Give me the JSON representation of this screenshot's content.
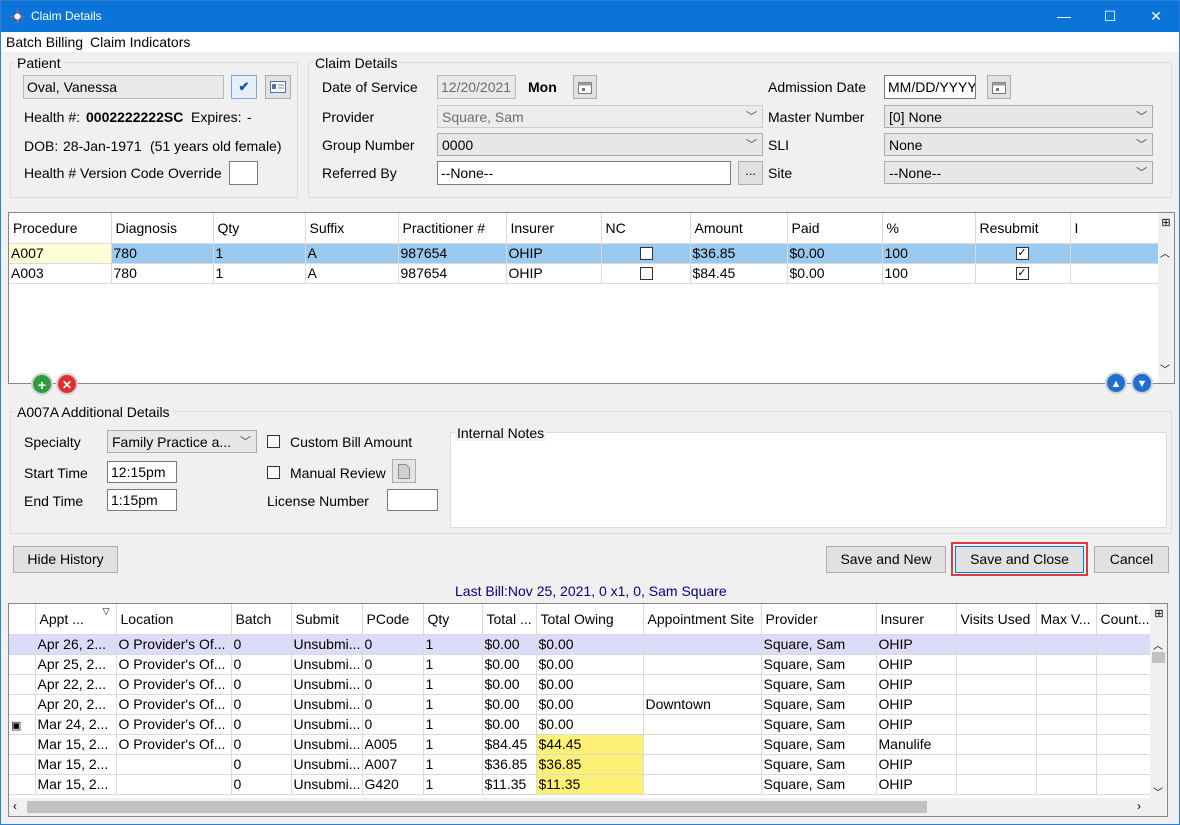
{
  "window": {
    "title": "Claim Details",
    "minimize": "—",
    "maximize": "☐",
    "close": "✕"
  },
  "menu": {
    "items": [
      "Batch Billing",
      "Claim Indicators"
    ]
  },
  "patient": {
    "group_title": "Patient",
    "name": "Oval, Vanessa",
    "health_label": "Health #:",
    "health_number": "0002222222SC",
    "expires_label": "Expires:",
    "expires_value": "-",
    "dob_label": "DOB:",
    "dob_value": "28-Jan-1971",
    "age_text": "(51 years old female)",
    "version_override_label": "Health # Version Code Override"
  },
  "claim": {
    "group_title": "Claim Details",
    "date_of_service_label": "Date of Service",
    "date_of_service": "12/20/2021",
    "day": "Mon",
    "provider_label": "Provider",
    "provider": "Square, Sam",
    "group_number_label": "Group Number",
    "group_number": "0000",
    "referred_by_label": "Referred By",
    "referred_by": "--None--",
    "admission_date_label": "Admission Date",
    "admission_date_placeholder": "MM/DD/YYYY",
    "master_number_label": "Master Number",
    "master_number": "[0] None",
    "sli_label": "SLI",
    "sli": "None",
    "site_label": "Site",
    "site": "--None--",
    "ellipsis": "..."
  },
  "procedures": {
    "columns": [
      "Procedure",
      "Diagnosis",
      "Qty",
      "Suffix",
      "Practitioner #",
      "Insurer",
      "NC",
      "Amount",
      "Paid",
      "%",
      "Resubmit",
      "I"
    ],
    "rows": [
      {
        "procedure": "A007",
        "diagnosis": "780",
        "qty": "1",
        "suffix": "A",
        "practitioner": "987654",
        "insurer": "OHIP",
        "nc": false,
        "amount": "$36.85",
        "paid": "$0.00",
        "pct": "100",
        "resubmit": true
      },
      {
        "procedure": "A003",
        "diagnosis": "780",
        "qty": "1",
        "suffix": "A",
        "practitioner": "987654",
        "insurer": "OHIP",
        "nc": false,
        "amount": "$84.45",
        "paid": "$0.00",
        "pct": "100",
        "resubmit": true
      }
    ]
  },
  "additional": {
    "group_title": "A007A Additional Details",
    "specialty_label": "Specialty",
    "specialty": "Family Practice a...",
    "start_time_label": "Start Time",
    "start_time": "12:15pm",
    "end_time_label": "End Time",
    "end_time": "1:15pm",
    "custom_bill_label": "Custom Bill Amount",
    "manual_review_label": "Manual Review",
    "license_label": "License Number",
    "internal_notes_label": "Internal Notes"
  },
  "actions": {
    "hide_history": "Hide History",
    "save_new": "Save and New",
    "save_close": "Save and Close",
    "cancel": "Cancel"
  },
  "last_bill": "Last Bill:Nov 25, 2021, 0 x1, 0, Sam Square",
  "history": {
    "columns": [
      "Appt ...",
      "Location",
      "Batch",
      "Submit",
      "PCode",
      "Qty",
      "Total ...",
      "Total Owing",
      "Appointment Site",
      "Provider",
      "Insurer",
      "Visits Used",
      "Max V...",
      "Count..."
    ],
    "rows": [
      {
        "appt": "Apr 26, 2...",
        "location": "O Provider's Of...",
        "batch": "0",
        "submit": "Unsubmi...",
        "pcode": "0",
        "qty": "1",
        "total": "$0.00",
        "owing": "$0.00",
        "site": "",
        "provider": "Square, Sam",
        "insurer": "OHIP",
        "highlight": false
      },
      {
        "appt": "Apr 25, 2...",
        "location": "O Provider's Of...",
        "batch": "0",
        "submit": "Unsubmi...",
        "pcode": "0",
        "qty": "1",
        "total": "$0.00",
        "owing": "$0.00",
        "site": "",
        "provider": "Square, Sam",
        "insurer": "OHIP",
        "highlight": false
      },
      {
        "appt": "Apr 22, 2...",
        "location": "O Provider's Of...",
        "batch": "0",
        "submit": "Unsubmi...",
        "pcode": "0",
        "qty": "1",
        "total": "$0.00",
        "owing": "$0.00",
        "site": "",
        "provider": "Square, Sam",
        "insurer": "OHIP",
        "highlight": false
      },
      {
        "appt": "Apr 20, 2...",
        "location": "O Provider's Of...",
        "batch": "0",
        "submit": "Unsubmi...",
        "pcode": "0",
        "qty": "1",
        "total": "$0.00",
        "owing": "$0.00",
        "site": "Downtown",
        "provider": "Square, Sam",
        "insurer": "OHIP",
        "highlight": false
      },
      {
        "appt": "Mar 24, 2...",
        "location": "O Provider's Of...",
        "batch": "0",
        "submit": "Unsubmi...",
        "pcode": "0",
        "qty": "1",
        "total": "$0.00",
        "owing": "$0.00",
        "site": "",
        "provider": "Square, Sam",
        "insurer": "OHIP",
        "highlight": false
      },
      {
        "appt": "Mar 15, 2...",
        "location": "O Provider's Of...",
        "batch": "0",
        "submit": "Unsubmi...",
        "pcode": "A005",
        "qty": "1",
        "total": "$84.45",
        "owing": "$44.45",
        "site": "",
        "provider": "Square, Sam",
        "insurer": "Manulife",
        "highlight": true
      },
      {
        "appt": "Mar 15, 2...",
        "location": "",
        "batch": "0",
        "submit": "Unsubmi...",
        "pcode": "A007",
        "qty": "1",
        "total": "$36.85",
        "owing": "$36.85",
        "site": "",
        "provider": "Square, Sam",
        "insurer": "OHIP",
        "highlight": true
      },
      {
        "appt": "Mar 15, 2...",
        "location": "",
        "batch": "0",
        "submit": "Unsubmi...",
        "pcode": "G420",
        "qty": "1",
        "total": "$11.35",
        "owing": "$11.35",
        "site": "",
        "provider": "Square, Sam",
        "insurer": "OHIP",
        "highlight": true
      }
    ]
  },
  "colors": {
    "titlebar": "#0a74d8",
    "selected_row": "#99c9ef",
    "first_history_row": "#dcdcf8",
    "owing_highlight": "#fff176",
    "save_close_border": "#e0393e",
    "link_text": "#00007f"
  }
}
